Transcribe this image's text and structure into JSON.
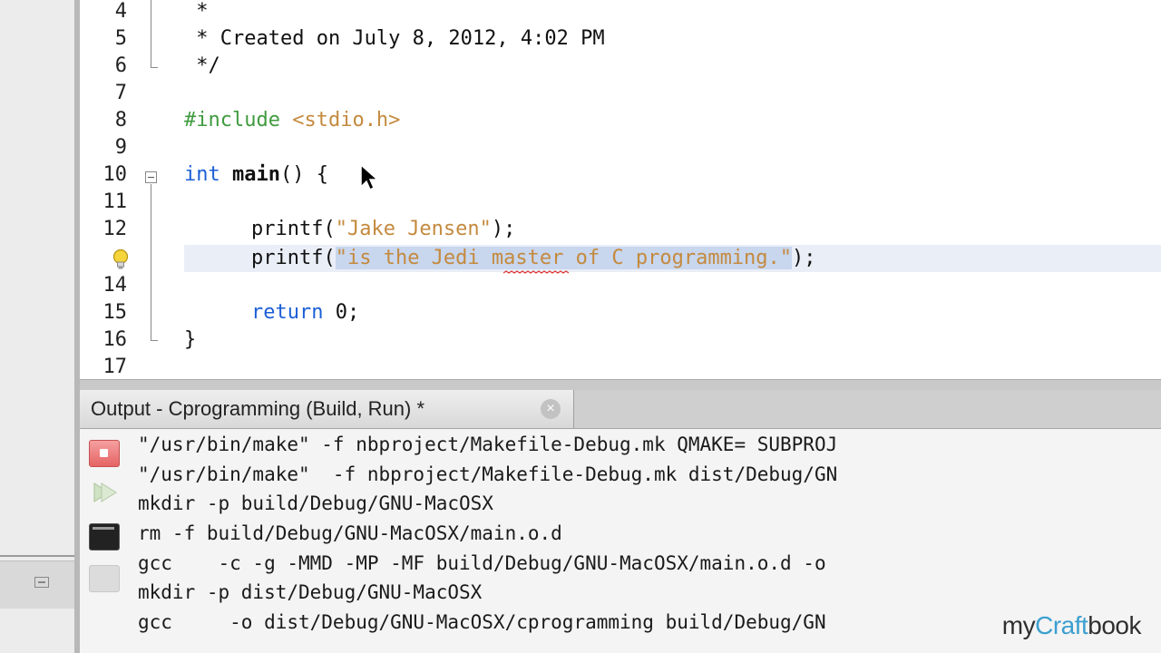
{
  "editor": {
    "lines": [
      {
        "num": "4",
        "text": " *"
      },
      {
        "num": "5",
        "text": " * Created on July 8, 2012, 4:02 PM"
      },
      {
        "num": "6",
        "text": " */"
      },
      {
        "num": "7",
        "text": ""
      },
      {
        "num": "8",
        "directive": "#include",
        "header": "<stdio.h>"
      },
      {
        "num": "9",
        "text": ""
      },
      {
        "num": "10",
        "keyword": "int",
        "name": "main",
        "rest": "() {"
      },
      {
        "num": "11",
        "text": ""
      },
      {
        "num": "12",
        "fn": "printf(",
        "str": "\"Jake Jensen\"",
        "end": ");"
      },
      {
        "num": "",
        "fn": "printf(",
        "str": "\"is the Jedi master of C programming.\"",
        "end": ");"
      },
      {
        "num": "14",
        "text": ""
      },
      {
        "num": "15",
        "keyword": "return",
        "rest": " 0;"
      },
      {
        "num": "16",
        "text": "}"
      },
      {
        "num": "17",
        "text": ""
      }
    ]
  },
  "output": {
    "tab_title": "Output - Cprogramming (Build, Run)",
    "tab_modified": "*",
    "close_glyph": "×",
    "lines": [
      "\"/usr/bin/make\" -f nbproject/Makefile-Debug.mk QMAKE= SUBPROJ",
      "\"/usr/bin/make\"  -f nbproject/Makefile-Debug.mk dist/Debug/GN",
      "mkdir -p build/Debug/GNU-MacOSX",
      "rm -f build/Debug/GNU-MacOSX/main.o.d",
      "gcc    -c -g -MMD -MP -MF build/Debug/GNU-MacOSX/main.o.d -o",
      "mkdir -p dist/Debug/GNU-MacOSX",
      "gcc     -o dist/Debug/GNU-MacOSX/cprogramming build/Debug/GN"
    ]
  },
  "watermark": {
    "left": "my",
    "mid": "Craft",
    "right": "book"
  },
  "colors": {
    "keyword": "#1c5fd6",
    "string": "#c48a3e",
    "directive": "#3f9b3f",
    "comment": "#9a9a9a"
  }
}
